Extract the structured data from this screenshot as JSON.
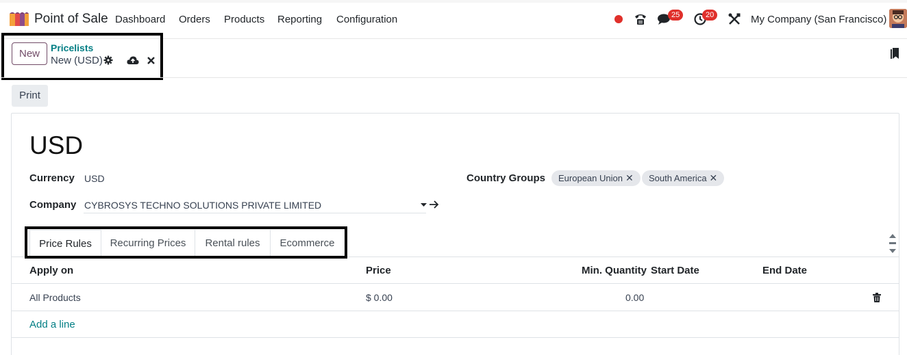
{
  "navbar": {
    "app_name": "Point of Sale",
    "menu": [
      "Dashboard",
      "Orders",
      "Products",
      "Reporting",
      "Configuration"
    ],
    "chat_badge": "25",
    "activity_badge": "20",
    "company": "My Company (San Francisco)",
    "icons": [
      "status-dot-icon",
      "phone-icon",
      "chat-icon",
      "clock-icon",
      "tools-icon",
      "avatar"
    ]
  },
  "control_panel": {
    "new_label": "New",
    "breadcrumb": "Pricelists",
    "record_name": "New (USD)",
    "icons": [
      "gear-icon",
      "cloud-upload-icon",
      "close-icon",
      "bookmark-icon"
    ]
  },
  "actions": {
    "print_label": "Print"
  },
  "form": {
    "title": "USD",
    "currency_label": "Currency",
    "currency_value": "USD",
    "company_label": "Company",
    "company_value": "CYBROSYS TECHNO SOLUTIONS PRIVATE LIMITED",
    "country_groups_label": "Country Groups",
    "country_groups": [
      "European Union",
      "South America"
    ]
  },
  "tabs": [
    "Price Rules",
    "Recurring Prices",
    "Rental rules",
    "Ecommerce"
  ],
  "table": {
    "headers": [
      "Apply on",
      "Price",
      "Min. Quantity",
      "Start Date",
      "End Date"
    ],
    "rows": [
      {
        "apply_on": "All Products",
        "price": "$ 0.00",
        "min_qty": "0.00",
        "start": "",
        "end": ""
      }
    ],
    "add_line_label": "Add a line"
  },
  "colors": {
    "accent": "#714b67",
    "link": "#017e84",
    "badge": "#e0302b"
  }
}
